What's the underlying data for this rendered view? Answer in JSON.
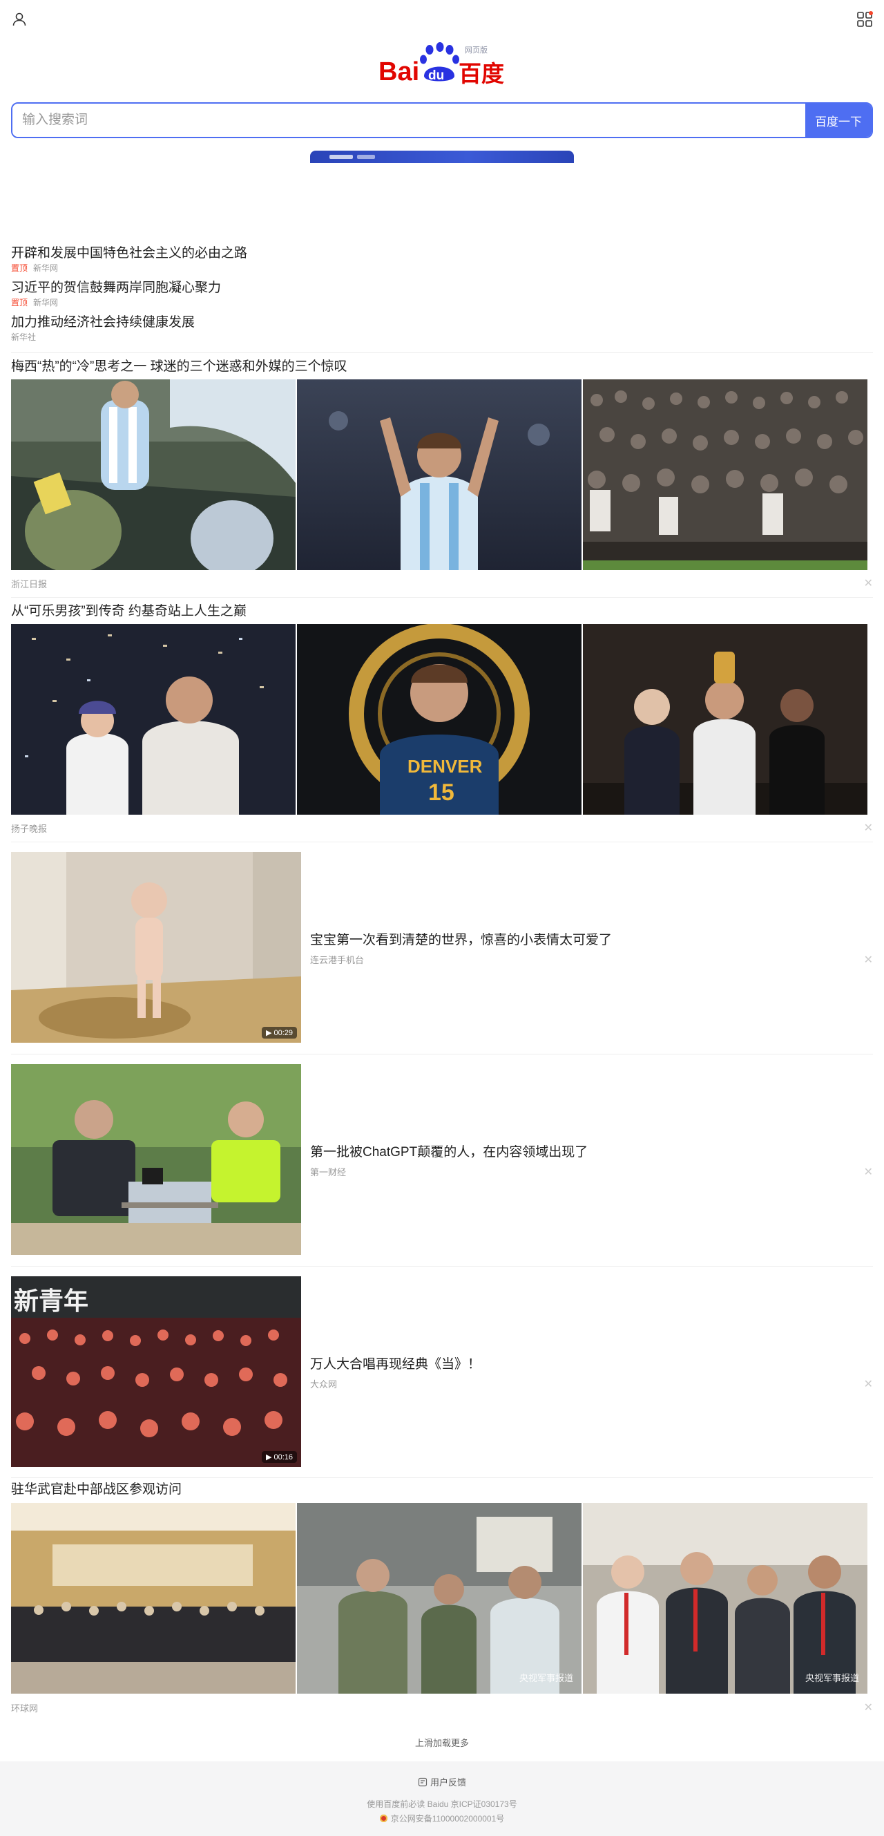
{
  "header": {
    "logo_wordmark": "Bai du 百度",
    "logo_badge": "网页版",
    "brand_colors": {
      "red": "#e10601",
      "blue": "#2932e1"
    }
  },
  "search": {
    "placeholder": "输入搜索词",
    "button_label": "百度一下",
    "accent": "#4e6ef2"
  },
  "hot_list": [
    {
      "title": "开辟和发展中国特色社会主义的必由之路",
      "tag": "置顶",
      "source": "新华网"
    },
    {
      "title": "习近平的贺信鼓舞两岸同胞凝心聚力",
      "tag": "置顶",
      "source": "新华网"
    },
    {
      "title": "加力推动经济社会持续健康发展",
      "tag": "",
      "source": "新华社"
    }
  ],
  "feed": [
    {
      "title": "梅西“热”的“冷”思考之一 球迷的三个迷惑和外媒的三个惊叹",
      "source": "浙江日报"
    },
    {
      "title": "从“可乐男孩”到传奇 约基奇站上人生之巅",
      "source": "扬子晚报"
    },
    {
      "title": "宝宝第一次看到清楚的世界，惊喜的小表情太可爱了",
      "source": "连云港手机台",
      "duration": "00:29"
    },
    {
      "title": "第一批被ChatGPT颠覆的人，在内容领域出现了",
      "source": "第一财经"
    },
    {
      "title": "万人大合唱再现经典《当》！",
      "source": "大众网",
      "duration": "00:16"
    },
    {
      "title": "驻华武官赴中部战区参观访问",
      "source": "环球网",
      "watermark": "央视军事报道"
    }
  ],
  "load_more": "上滑加载更多",
  "footer": {
    "feedback": "用户反馈",
    "line1": "使用百度前必读 Baidu 京ICP证030173号",
    "line2": "京公网安备11000002000001号"
  }
}
